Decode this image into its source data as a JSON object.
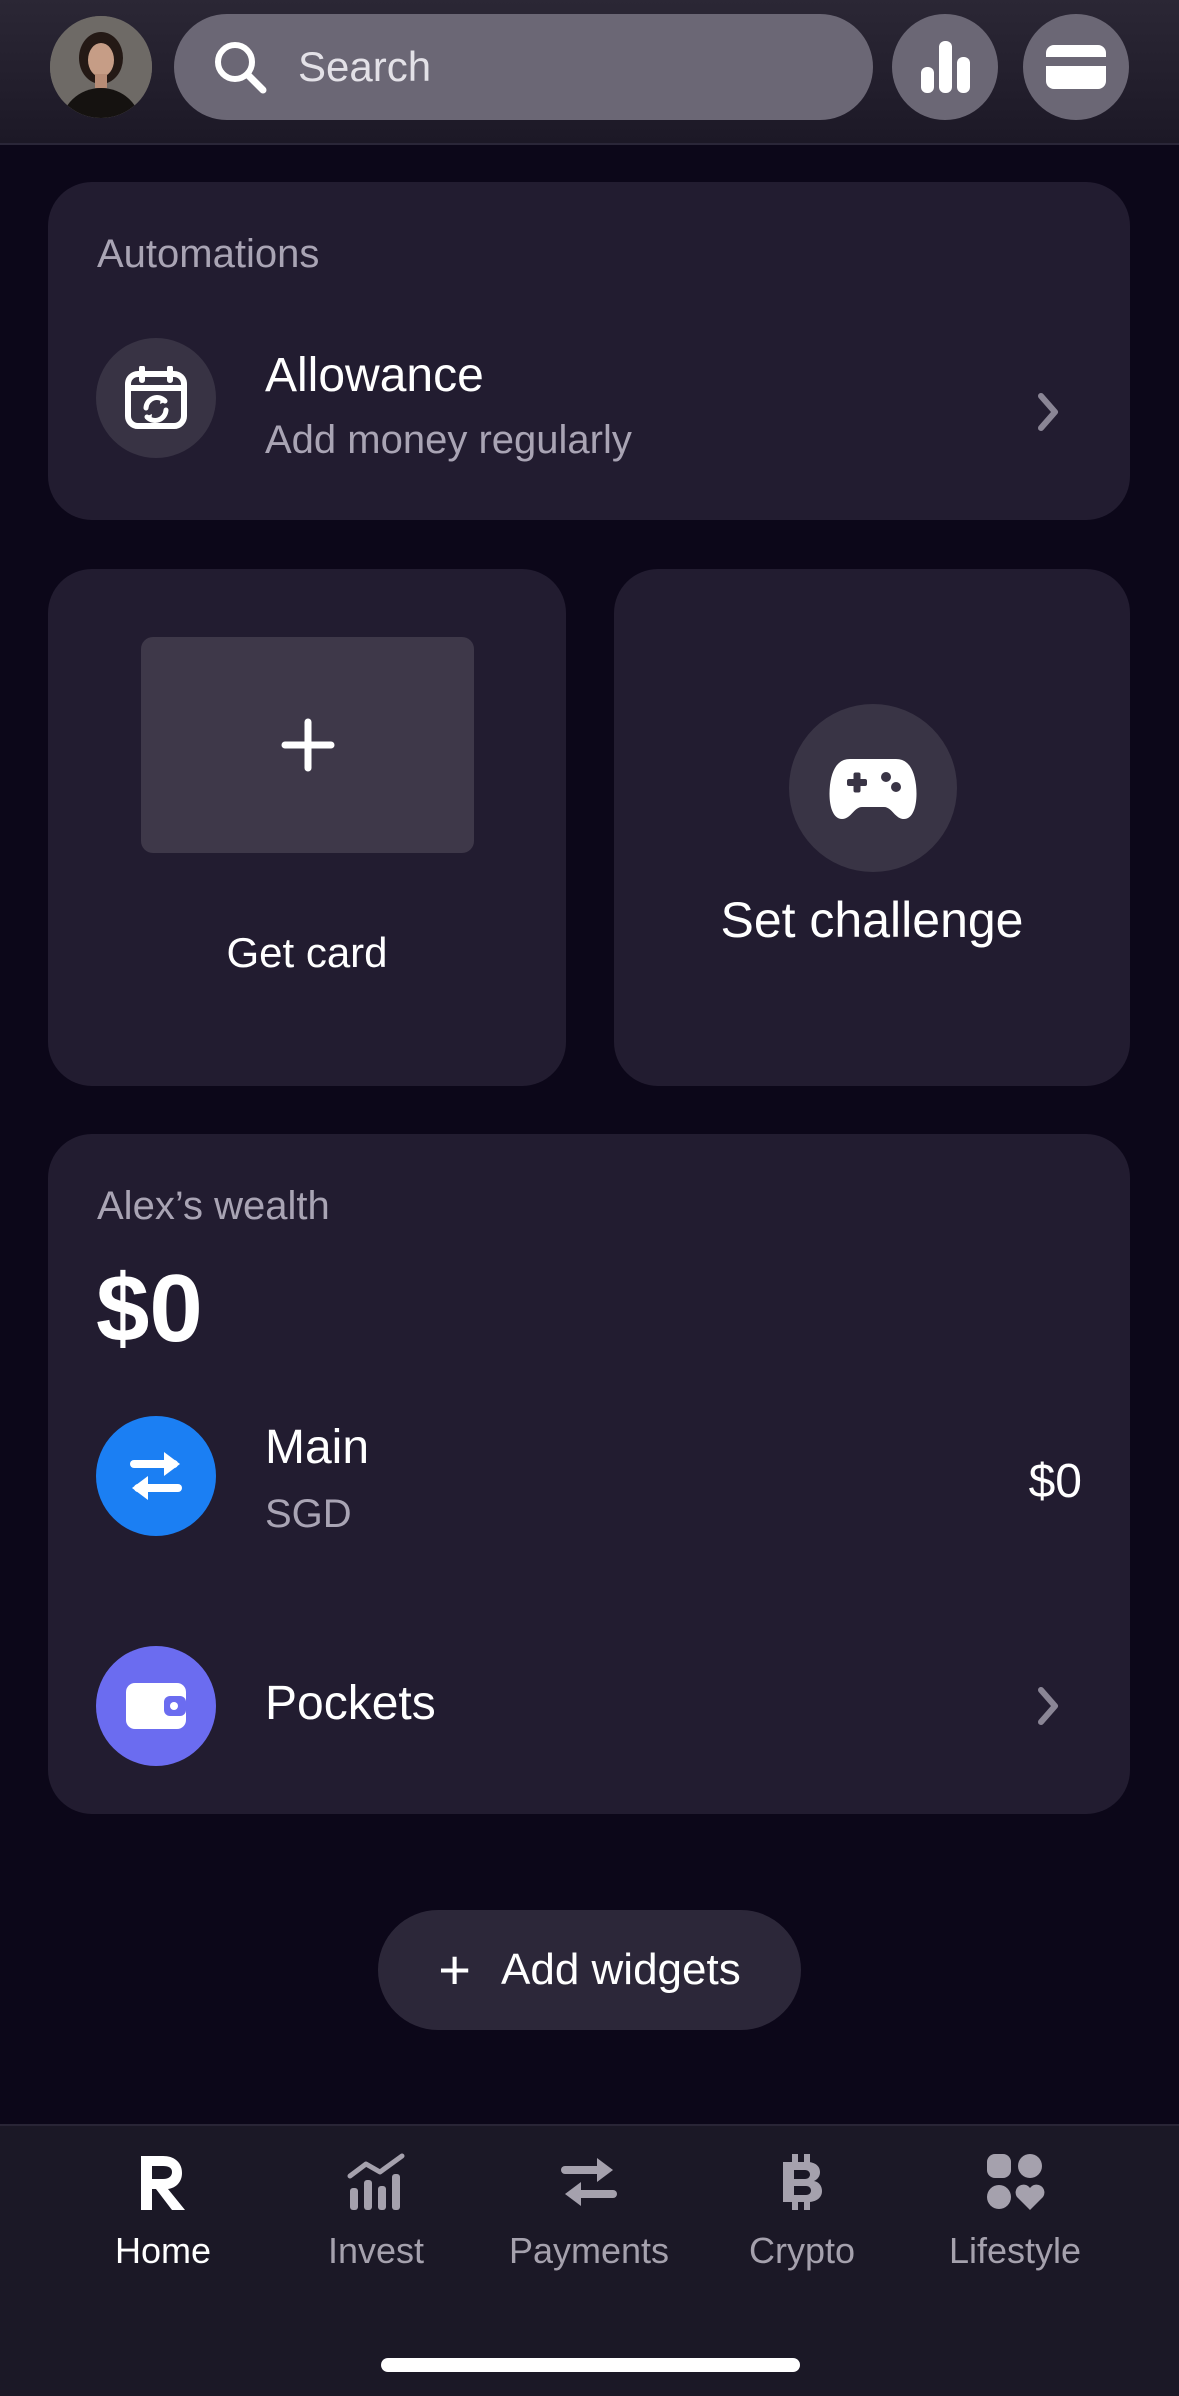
{
  "header": {
    "avatar_icon": "profile-photo",
    "search_placeholder": "Search",
    "stats_icon": "bar-chart-icon",
    "cards_icon": "card-icon"
  },
  "automations": {
    "heading": "Automations",
    "allowance": {
      "title": "Allowance",
      "subtitle": "Add money regularly",
      "icon": "calendar-repeat-icon"
    }
  },
  "get_card": {
    "label": "Get card",
    "icon": "plus-icon"
  },
  "challenge": {
    "label": "Set challenge",
    "icon": "gamepad-icon"
  },
  "wealth": {
    "heading": "Alex’s wealth",
    "total": "$0",
    "accounts": [
      {
        "title": "Main",
        "subtitle": "SGD",
        "value": "$0",
        "icon": "exchange-icon",
        "color": "#1b7ff3"
      },
      {
        "title": "Pockets",
        "icon": "wallet-icon",
        "color": "#6b6cf0"
      }
    ]
  },
  "add_widgets": {
    "label": "Add widgets"
  },
  "nav": {
    "items": [
      {
        "label": "Home",
        "icon": "revolut-logo-icon",
        "active": true
      },
      {
        "label": "Invest",
        "icon": "invest-chart-icon"
      },
      {
        "label": "Payments",
        "icon": "arrows-transfer-icon"
      },
      {
        "label": "Crypto",
        "icon": "bitcoin-icon"
      },
      {
        "label": "Lifestyle",
        "icon": "lifestyle-grid-icon"
      }
    ]
  },
  "colors": {
    "background": "#0c0719",
    "card": "#221c30",
    "accent_blue": "#1b7ff3",
    "accent_purple": "#6b6cf0"
  }
}
